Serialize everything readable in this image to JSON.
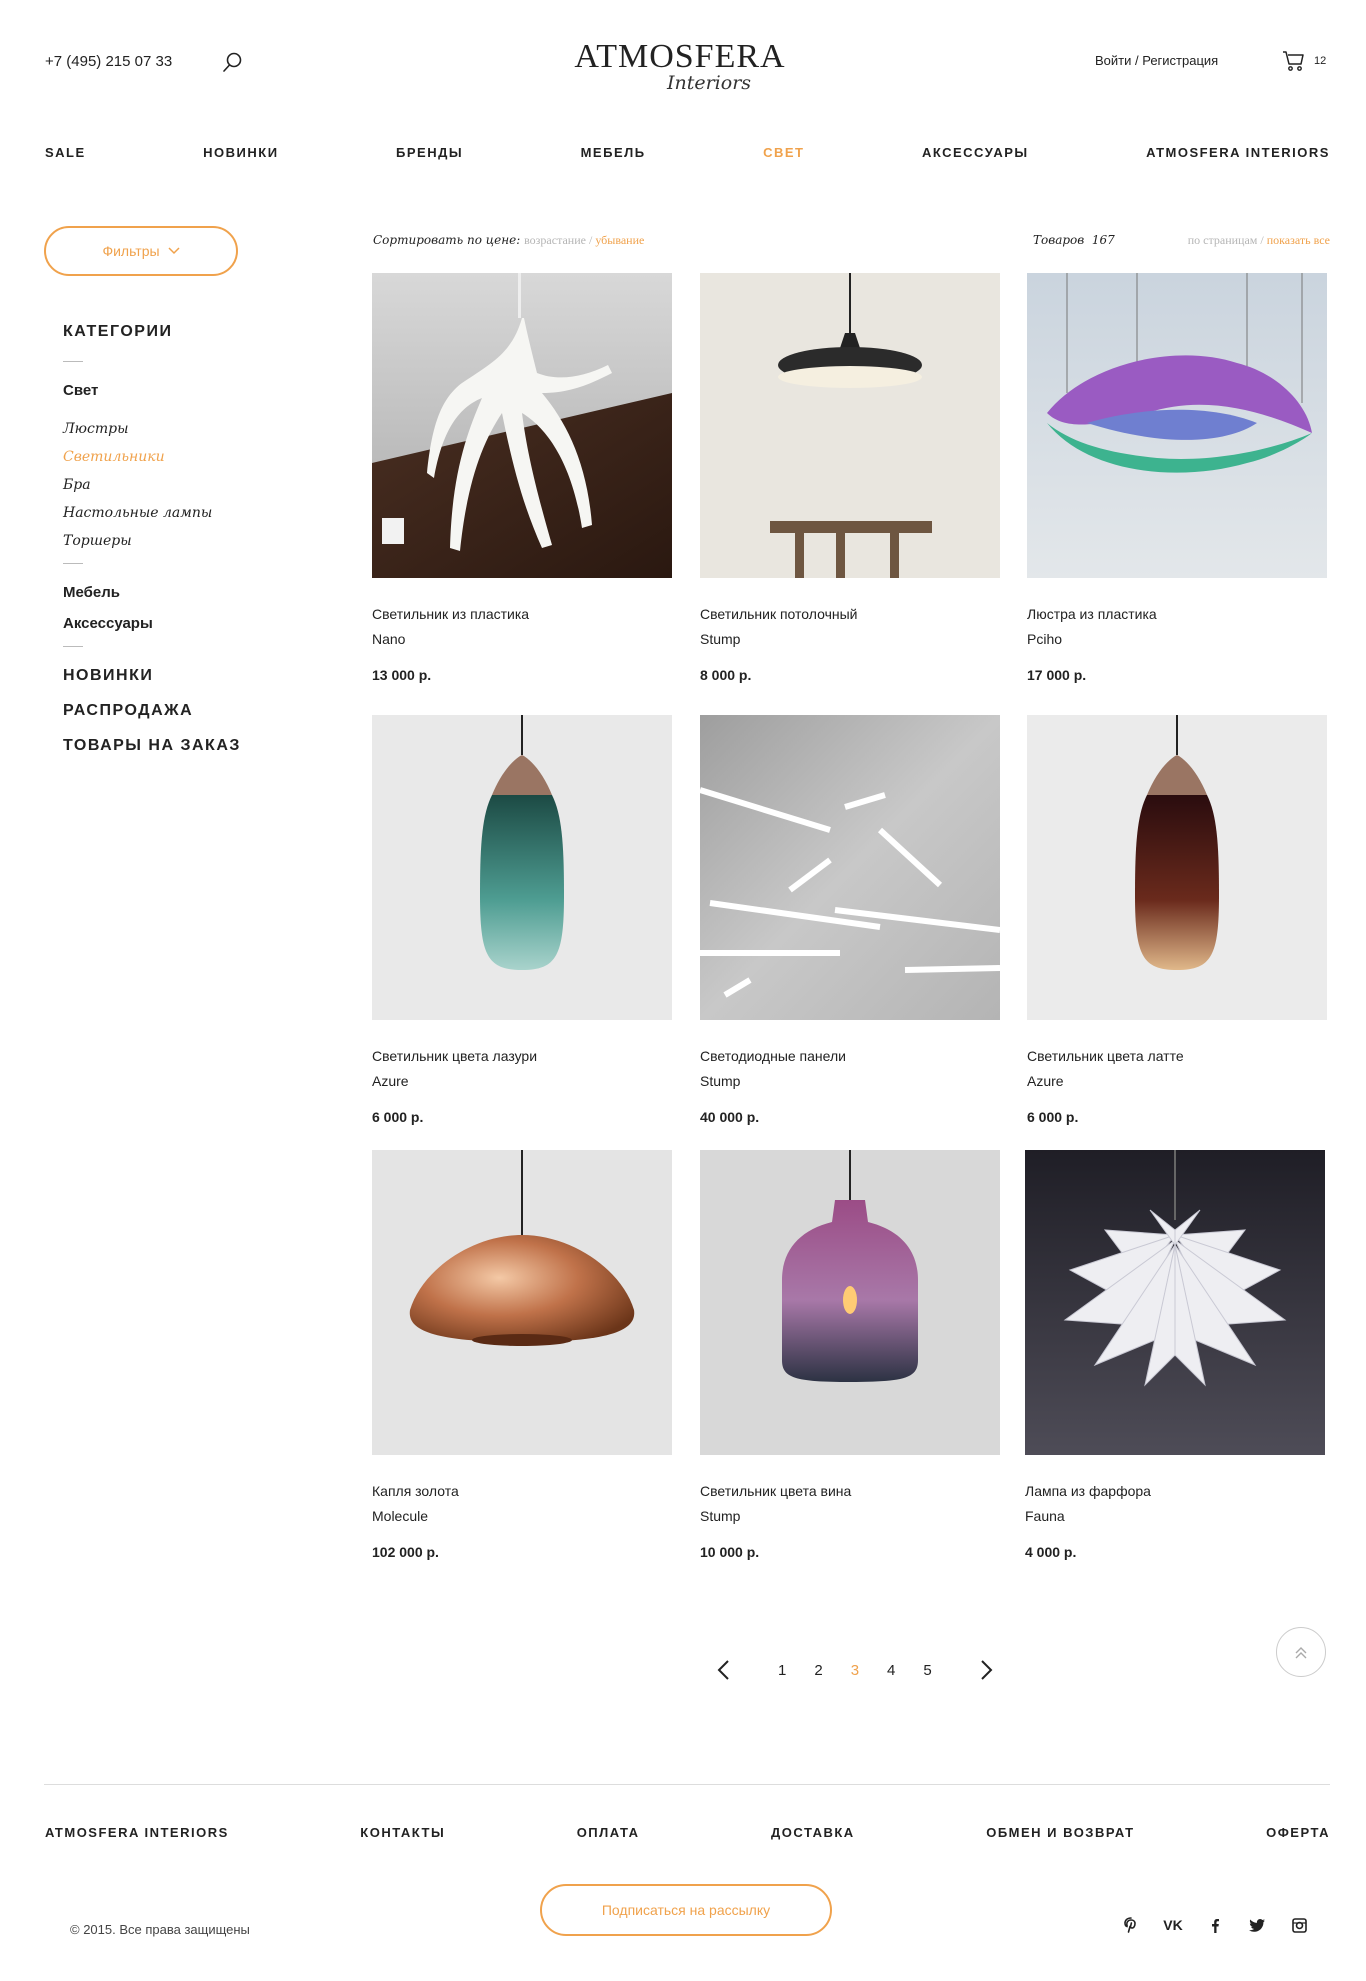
{
  "header": {
    "phone": "+7 (495) 215 07 33",
    "logo_main": "ATMOSFERA",
    "logo_script": "Interiors",
    "auth": "Войти / Регистрация",
    "cart_count": "12"
  },
  "nav": [
    "SALE",
    "НОВИНКИ",
    "БРЕНДЫ",
    "МЕБЕЛЬ",
    "СВЕТ",
    "АКСЕССУАРЫ",
    "ATMOSFERA INTERIORS"
  ],
  "filters_label": "Фильтры",
  "sidebar": {
    "title": "КАТЕГОРИИ",
    "current": "Свет",
    "subitems": [
      "Люстры",
      "Светильники",
      "Бра",
      "Настольные лампы",
      "Торшеры"
    ],
    "others": [
      "Мебель",
      "Аксессуары"
    ],
    "upper": [
      "НОВИНКИ",
      "РАСПРОДАЖА",
      "ТОВАРЫ НА ЗАКАЗ"
    ]
  },
  "sort": {
    "label": "Сортировать по цене:",
    "asc": "возрастание",
    "sep": " / ",
    "desc": "убывание"
  },
  "count": {
    "label": "Товаров",
    "value": "167"
  },
  "per_page": {
    "pages": "по страницам",
    "sep": " / ",
    "all": "показать все"
  },
  "products": [
    {
      "title": "Светильник из пластика",
      "brand": "Nano",
      "price": "13 000 р."
    },
    {
      "title": "Светильник потолочный",
      "brand": "Stump",
      "price": "8 000 р."
    },
    {
      "title": "Люстра из пластика",
      "brand": "Pciho",
      "price": "17 000 р."
    },
    {
      "title": "Светильник цвета лазури",
      "brand": "Azure",
      "price": "6 000 р."
    },
    {
      "title": "Светодиодные панели",
      "brand": "Stump",
      "price": "40 000 р."
    },
    {
      "title": "Светильник цвета латте",
      "brand": "Azure",
      "price": "6 000 р."
    },
    {
      "title": "Капля золота",
      "brand": "Molecule",
      "price": "102 000 р."
    },
    {
      "title": "Светильник цвета вина",
      "brand": "Stump",
      "price": "10 000 р."
    },
    {
      "title": "Лампа из фарфора",
      "brand": "Fauna",
      "price": "4 000 р."
    }
  ],
  "pagination": {
    "pages": [
      "1",
      "2",
      "3",
      "4",
      "5"
    ],
    "current": "3"
  },
  "footer": {
    "nav": [
      "ATMOSFERA INTERIORS",
      "КОНТАКТЫ",
      "ОПЛАТА",
      "ДОСТАВКА",
      "ОБМЕН И ВОЗВРАТ",
      "ОФЕРТА"
    ],
    "subscribe": "Подписаться на рассылку",
    "copyright": "© 2015. Все права защищены",
    "socials": [
      "pinterest-icon",
      "vk-icon",
      "facebook-icon",
      "twitter-icon",
      "instagram-icon"
    ],
    "vk_label": "VK"
  },
  "colors": {
    "accent": "#f0a24c",
    "text": "#222222"
  }
}
